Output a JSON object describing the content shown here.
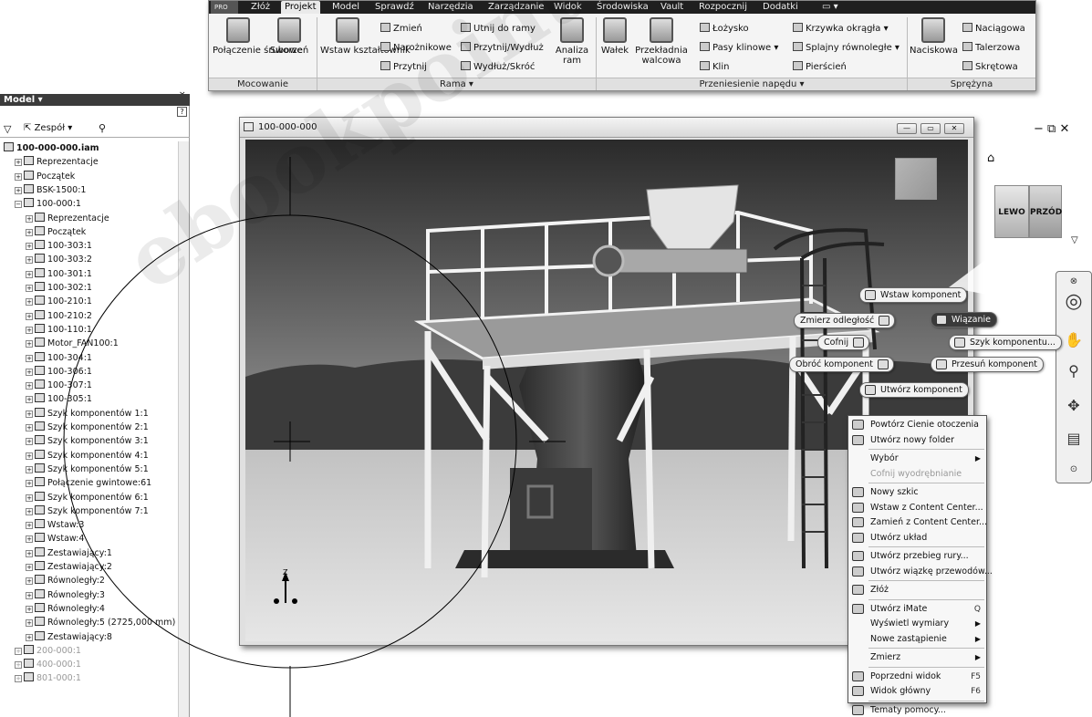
{
  "ribbon": {
    "tabs": [
      "Złóż",
      "Projekt",
      "Model",
      "Sprawdź",
      "Narzędzia",
      "Zarządzanie",
      "Widok",
      "Środowiska",
      "Vault",
      "Rozpocznij",
      "Dodatki"
    ],
    "active_tab": "Projekt",
    "app_badge": "PRO",
    "groups": {
      "mocowanie": {
        "label": "Mocowanie",
        "items": [
          "Połączenie śrubowe",
          "Sworzeń"
        ]
      },
      "rama": {
        "label": "Rama ▾",
        "big": "Wstaw kształtownik",
        "small": [
          "Zmień",
          "Narożnikowe",
          "Przytnij",
          "Utnij do ramy",
          "Przytnij/Wydłuż",
          "Wydłuż/Skróć"
        ],
        "analiza": "Analiza ram"
      },
      "naped": {
        "label": "Przeniesienie napędu ▾",
        "big": [
          "Wałek",
          "Przekładnia walcowa"
        ],
        "small": [
          "Łożysko",
          "Pasy klinowe",
          "Klin",
          "Krzywka okrągła",
          "Splajny równoległe",
          "Pierścień"
        ]
      },
      "sprezyna": {
        "label": "Sprężyna",
        "big": "Naciskowa",
        "small": [
          "Naciągowa",
          "Talerzowa",
          "Skrętowa"
        ]
      }
    }
  },
  "browser": {
    "title": "Model ▾",
    "filter_label": "Zespół",
    "tree": [
      {
        "label": "100-000-000.iam",
        "level": 0,
        "bold": true
      },
      {
        "label": "Reprezentacje",
        "level": 1
      },
      {
        "label": "Początek",
        "level": 1
      },
      {
        "label": "BSK-1500:1",
        "level": 1
      },
      {
        "label": "100-000:1",
        "level": 1
      },
      {
        "label": "Reprezentacje",
        "level": 2
      },
      {
        "label": "Początek",
        "level": 2
      },
      {
        "label": "100-303:1",
        "level": 2
      },
      {
        "label": "100-303:2",
        "level": 2
      },
      {
        "label": "100-301:1",
        "level": 2
      },
      {
        "label": "100-302:1",
        "level": 2
      },
      {
        "label": "100-210:1",
        "level": 2
      },
      {
        "label": "100-210:2",
        "level": 2
      },
      {
        "label": "100-110:1",
        "level": 2
      },
      {
        "label": "Motor_FAN100:1",
        "level": 2
      },
      {
        "label": "100-304:1",
        "level": 2
      },
      {
        "label": "100-306:1",
        "level": 2
      },
      {
        "label": "100-307:1",
        "level": 2
      },
      {
        "label": "100-305:1",
        "level": 2
      },
      {
        "label": "Szyk komponentów 1:1",
        "level": 2
      },
      {
        "label": "Szyk komponentów 2:1",
        "level": 2
      },
      {
        "label": "Szyk komponentów 3:1",
        "level": 2
      },
      {
        "label": "Szyk komponentów 4:1",
        "level": 2
      },
      {
        "label": "Szyk komponentów 5:1",
        "level": 2
      },
      {
        "label": "Połączenie gwintowe:61",
        "level": 2
      },
      {
        "label": "Szyk komponentów 6:1",
        "level": 2
      },
      {
        "label": "Szyk komponentów 7:1",
        "level": 2
      },
      {
        "label": "Wstaw:3",
        "level": 2
      },
      {
        "label": "Wstaw:4",
        "level": 2
      },
      {
        "label": "Zestawiający:1",
        "level": 2
      },
      {
        "label": "Zestawiający:2",
        "level": 2
      },
      {
        "label": "Równoległy:2",
        "level": 2
      },
      {
        "label": "Równoległy:3",
        "level": 2
      },
      {
        "label": "Równoległy:4",
        "level": 2
      },
      {
        "label": "Równoległy:5 (2725,000 mm)",
        "level": 2
      },
      {
        "label": "Zestawiający:8",
        "level": 2
      },
      {
        "label": "200-000:1",
        "level": 1,
        "gray": true
      },
      {
        "label": "400-000:1",
        "level": 1,
        "gray": true
      },
      {
        "label": "801-000:1",
        "level": 1,
        "gray": true
      }
    ]
  },
  "viewport": {
    "title": "100-000-000",
    "viewcube": {
      "left": "LEWO",
      "front": "PRZÓD"
    }
  },
  "marking_menu": {
    "north": "Wstaw komponent",
    "northwest": "Zmierz odległość",
    "west": "Cofnij",
    "southwest": "Obróć komponent",
    "south": "Utwórz komponent",
    "east": "Przesuń komponent",
    "northeast": "Wiązanie",
    "northeast2": "Szyk komponentu..."
  },
  "context_menu": {
    "items": [
      {
        "label": "Powtórz Cienie otoczenia"
      },
      {
        "label": "Utwórz nowy folder"
      },
      {
        "label": "Wybór",
        "submenu": true
      },
      {
        "label": "Cofnij wyodrębnianie",
        "disabled": true
      },
      {
        "label": "Nowy szkic"
      },
      {
        "label": "Wstaw z Content Center..."
      },
      {
        "label": "Zamień z Content Center..."
      },
      {
        "label": "Utwórz układ"
      },
      {
        "label": "Utwórz przebieg rury..."
      },
      {
        "label": "Utwórz wiązkę przewodów..."
      },
      {
        "label": "Złóż"
      },
      {
        "label": "Utwórz iMate",
        "shortcut": "Q"
      },
      {
        "label": "Wyświetl wymiary",
        "submenu": true
      },
      {
        "label": "Nowe zastąpienie",
        "submenu": true
      },
      {
        "label": "Zmierz",
        "submenu": true
      },
      {
        "label": "Poprzedni widok",
        "shortcut": "F5"
      },
      {
        "label": "Widok główny",
        "shortcut": "F6"
      },
      {
        "label": "Tematy pomocy..."
      }
    ]
  },
  "triad": {
    "z": "Z"
  },
  "colors": {
    "ribbon_tab_bg": "#1f1f1f",
    "panel_bg": "#f4f4f4",
    "highlight": "#2e2e2e"
  }
}
